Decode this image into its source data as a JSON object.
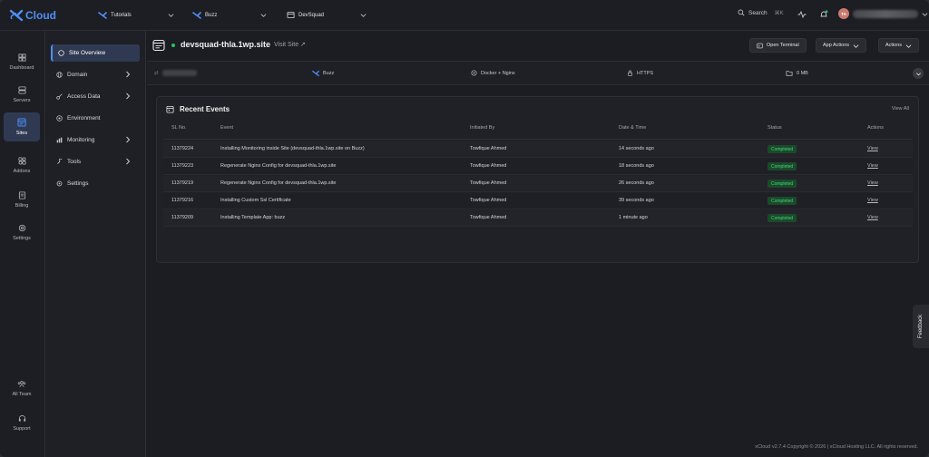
{
  "brand": {
    "name": "Cloud",
    "accent": "#4f8ff7"
  },
  "topbar": {
    "crumbs": [
      {
        "label": "Tutorials",
        "icon": "xcloud-icon"
      },
      {
        "label": "Buzz",
        "icon": "xcloud-icon"
      },
      {
        "label": "DevSquad",
        "icon": "server-icon"
      }
    ],
    "search_label": "Search",
    "search_shortcut": "⌘K",
    "user_initials": "TA"
  },
  "rail": {
    "items": [
      {
        "label": "Dashboard",
        "icon": "dashboard-icon"
      },
      {
        "label": "Servers",
        "icon": "server-icon"
      },
      {
        "label": "Sites",
        "icon": "sites-icon",
        "active": true
      },
      {
        "label": "Addons",
        "icon": "addons-icon"
      },
      {
        "label": "Billing",
        "icon": "billing-icon"
      },
      {
        "label": "Settings",
        "icon": "settings-icon"
      }
    ],
    "bottom": [
      {
        "label": "All Team",
        "icon": "team-icon"
      },
      {
        "label": "Support",
        "icon": "headset-icon"
      }
    ]
  },
  "subnav": {
    "items": [
      {
        "label": "Site Overview",
        "active": true
      },
      {
        "label": "Domain",
        "has_arrow": true
      },
      {
        "label": "Access Data",
        "has_arrow": true
      },
      {
        "label": "Environment"
      },
      {
        "label": "Monitoring",
        "has_arrow": true
      },
      {
        "label": "Tools",
        "has_arrow": true
      },
      {
        "label": "Settings"
      }
    ]
  },
  "site": {
    "name": "devsquad-thla.1wp.site",
    "visit_label": "Visit Site ↗",
    "status_color": "#22c55e",
    "open_terminal_label": "Open Terminal",
    "app_actions_label": "App Actions",
    "actions_label": "Actions"
  },
  "info": {
    "server": "Buzz",
    "stack": "Docker + Nginx",
    "protocol": "HTTPS",
    "size": "0 MB"
  },
  "events": {
    "title": "Recent Events",
    "view_all": "View All",
    "columns": [
      "SL No.",
      "Event",
      "Initiated By",
      "Date & Time",
      "Status",
      "Actions"
    ],
    "rows": [
      {
        "sl": "11379224",
        "event": "Installing Monitoring inside Site (devsquad-thla.1wp.site on Buzz)",
        "by": "Towfique Ahmed",
        "time": "14 seconds ago",
        "status": "Completed",
        "action": "View"
      },
      {
        "sl": "11379223",
        "event": "Regenerate Nginx Config for devsquad-thla.1wp.site",
        "by": "Towfique Ahmed",
        "time": "18 seconds ago",
        "status": "Completed",
        "action": "View"
      },
      {
        "sl": "11379219",
        "event": "Regenerate Nginx Config for devsquad-thla.1wp.site",
        "by": "Towfique Ahmed",
        "time": "26 seconds ago",
        "status": "Completed",
        "action": "View"
      },
      {
        "sl": "11379216",
        "event": "Installing Custom Ssl Certificate",
        "by": "Towfique Ahmed",
        "time": "39 seconds ago",
        "status": "Completed",
        "action": "View"
      },
      {
        "sl": "11379209",
        "event": "Installing Template App: buzz",
        "by": "Towfique Ahmed",
        "time": "1 minute ago",
        "status": "Completed",
        "action": "View"
      }
    ]
  },
  "feedback_label": "Feedback",
  "footer": "xCloud v2.7.4 Copyright © 2026 | xCloud Hosting LLC. All rights reserved."
}
